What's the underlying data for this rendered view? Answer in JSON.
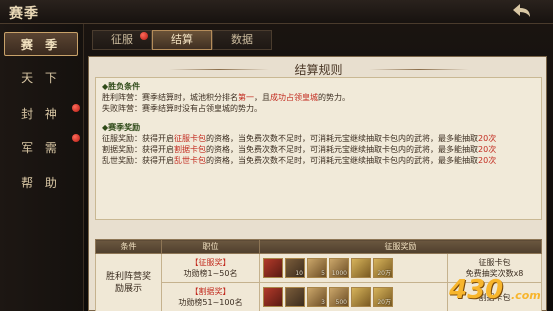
{
  "header": {
    "title": "赛季"
  },
  "sidebar": {
    "items": [
      {
        "label": "赛 季",
        "active": true,
        "dot": false
      },
      {
        "label": "天 下",
        "dot": false
      },
      {
        "label": "封 神",
        "dot": true
      },
      {
        "label": "军 需",
        "dot": true
      },
      {
        "label": "帮 助",
        "dot": false
      }
    ]
  },
  "tabs": [
    {
      "label": "征服",
      "dot": true
    },
    {
      "label": "结算",
      "active": true
    },
    {
      "label": "数据"
    }
  ],
  "panel": {
    "title": "结算规则",
    "victory": {
      "heading": "胜负条件",
      "win_pre": "胜利阵营：赛季结算时，城池积分排名",
      "win_rank": "第一",
      "win_mid": "，且",
      "win_cond": "成功占领皇城",
      "win_post": "的势力。",
      "lose": "失败阵营：赛季结算时没有占领皇城的势力。"
    },
    "reward": {
      "heading": "赛季奖励",
      "lines": [
        {
          "pre": "征服奖励：获得开启",
          "card": "征服卡包",
          "post": "的资格，当免费次数不足时，可消耗元宝继续抽取卡包内的武将，最多能抽取",
          "n": "20",
          "unit": "次"
        },
        {
          "pre": "割据奖励：获得开启",
          "card": "割据卡包",
          "post": "的资格，当免费次数不足时，可消耗元宝继续抽取卡包内的武将，最多能抽取",
          "n": "20",
          "unit": "次"
        },
        {
          "pre": "乱世奖励：获得开启",
          "card": "乱世卡包",
          "post": "的资格，当免费次数不足时，可消耗元宝继续抽取卡包内的武将，最多能抽取",
          "n": "20",
          "unit": "次"
        }
      ]
    }
  },
  "table": {
    "headers": [
      "条件",
      "职位",
      "征服奖励"
    ],
    "condition": "胜利阵营奖励展示",
    "rows": [
      {
        "tag": "【征服奖】",
        "rank": "功勋榜1~50名",
        "items": [
          {
            "icon": "general-card-icon",
            "count": ""
          },
          {
            "icon": "general-card-icon",
            "count": "10"
          },
          {
            "icon": "scroll-icon",
            "count": "5"
          },
          {
            "icon": "wood-icon",
            "count": "1000"
          },
          {
            "icon": "gold-coin-icon",
            "count": ""
          },
          {
            "icon": "gold-coin-icon",
            "count": "20万"
          }
        ],
        "pack": "征服卡包",
        "free": "免费抽奖次数x8"
      },
      {
        "tag": "【割据奖】",
        "rank": "功勋榜51~100名",
        "items": [
          {
            "icon": "general-card-icon",
            "count": ""
          },
          {
            "icon": "general-card-icon",
            "count": ""
          },
          {
            "icon": "scroll-icon",
            "count": "3"
          },
          {
            "icon": "wood-icon",
            "count": "500"
          },
          {
            "icon": "gold-coin-icon",
            "count": ""
          },
          {
            "icon": "gold-coin-icon",
            "count": "20万"
          }
        ],
        "pack": "割据卡包",
        "free": ""
      }
    ]
  },
  "watermark": {
    "text": "430",
    "suffix": ".com"
  }
}
